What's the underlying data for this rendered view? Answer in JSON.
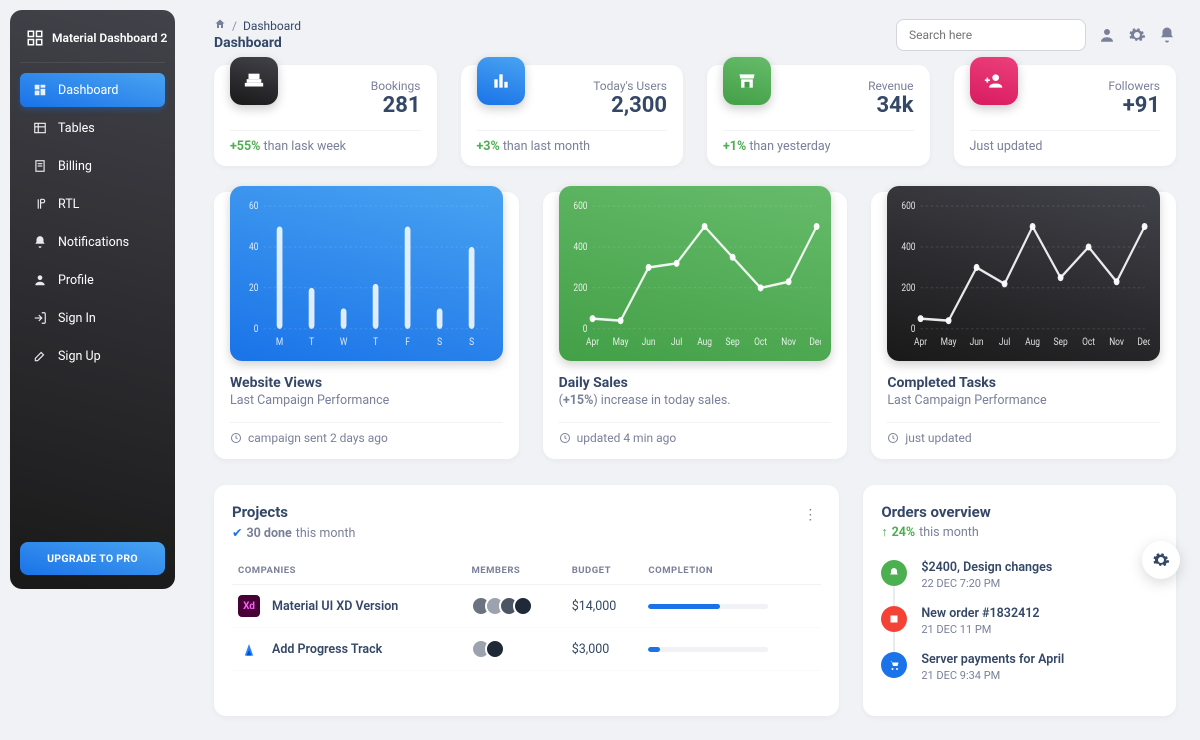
{
  "sidebar": {
    "title": "Material Dashboard 2",
    "items": [
      {
        "label": "Dashboard"
      },
      {
        "label": "Tables"
      },
      {
        "label": "Billing"
      },
      {
        "label": "RTL"
      },
      {
        "label": "Notifications"
      },
      {
        "label": "Profile"
      },
      {
        "label": "Sign In"
      },
      {
        "label": "Sign Up"
      }
    ],
    "upgrade": "UPGRADE TO PRO"
  },
  "breadcrumb": {
    "root": "Dashboard",
    "title": "Dashboard",
    "sep": "/"
  },
  "search": {
    "placeholder": "Search here"
  },
  "stats": [
    {
      "label": "Bookings",
      "value": "281",
      "delta": "+55%",
      "compare": " than lask week"
    },
    {
      "label": "Today's Users",
      "value": "2,300",
      "delta": "+3%",
      "compare": " than last month"
    },
    {
      "label": "Revenue",
      "value": "34k",
      "delta": "+1%",
      "compare": " than yesterday"
    },
    {
      "label": "Followers",
      "value": "+91",
      "delta": "",
      "compare": "Just updated"
    }
  ],
  "chart_data": [
    {
      "type": "bar",
      "title": "Website Views",
      "subtitle": "Last Campaign Performance",
      "footer": "campaign sent 2 days ago",
      "categories": [
        "M",
        "T",
        "W",
        "T",
        "F",
        "S",
        "S"
      ],
      "values": [
        50,
        20,
        10,
        22,
        50,
        10,
        40
      ],
      "ylim": [
        0,
        60
      ],
      "yticks": [
        0,
        20,
        40,
        60
      ]
    },
    {
      "type": "line",
      "title": "Daily Sales",
      "subtitle_prefix": "(",
      "subtitle_delta": "+15%",
      "subtitle_suffix": ") increase in today sales.",
      "footer": "updated 4 min ago",
      "categories": [
        "Apr",
        "May",
        "Jun",
        "Jul",
        "Aug",
        "Sep",
        "Oct",
        "Nov",
        "Dec"
      ],
      "values": [
        50,
        40,
        300,
        320,
        500,
        350,
        200,
        230,
        500
      ],
      "ylim": [
        0,
        600
      ],
      "yticks": [
        0,
        200,
        400,
        600
      ]
    },
    {
      "type": "line",
      "title": "Completed Tasks",
      "subtitle": "Last Campaign Performance",
      "footer": "just updated",
      "categories": [
        "Apr",
        "May",
        "Jun",
        "Jul",
        "Aug",
        "Sep",
        "Oct",
        "Nov",
        "Dec"
      ],
      "values": [
        50,
        40,
        300,
        220,
        500,
        250,
        400,
        230,
        500
      ],
      "ylim": [
        0,
        600
      ],
      "yticks": [
        0,
        200,
        400,
        600
      ]
    }
  ],
  "projects": {
    "title": "Projects",
    "done_count": "30 done",
    "done_suffix": " this month",
    "columns": {
      "companies": "COMPANIES",
      "members": "MEMBERS",
      "budget": "BUDGET",
      "completion": "COMPLETION"
    },
    "rows": [
      {
        "name": "Material UI XD Version",
        "members": 4,
        "budget": "$14,000",
        "completion": 60
      },
      {
        "name": "Add Progress Track",
        "members": 2,
        "budget": "$3,000",
        "completion": 10
      }
    ]
  },
  "orders": {
    "title": "Orders overview",
    "delta": "24%",
    "delta_suffix": " this month",
    "items": [
      {
        "title": "$2400, Design changes",
        "time": "22 DEC 7:20 PM",
        "color": "#4caf50"
      },
      {
        "title": "New order #1832412",
        "time": "21 DEC 11 PM",
        "color": "#f44336"
      },
      {
        "title": "Server payments for April",
        "time": "21 DEC 9:34 PM",
        "color": "#1a73e8"
      }
    ]
  }
}
